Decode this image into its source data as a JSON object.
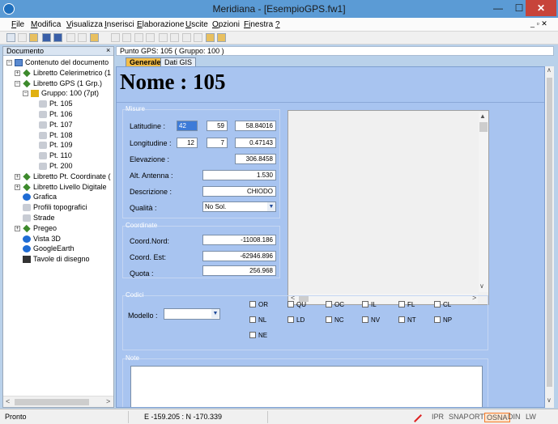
{
  "window": {
    "title": "Meridiana - [EsempioGPS.fw1]",
    "min_label": "—",
    "max_label": "☐",
    "close_label": "✕"
  },
  "menu": {
    "items": [
      {
        "first": "F",
        "rest": "ile"
      },
      {
        "first": "M",
        "rest": "odifica"
      },
      {
        "first": "V",
        "rest": "isualizza"
      },
      {
        "first": "I",
        "rest": "nserisci"
      },
      {
        "first": "E",
        "rest": "laborazione"
      },
      {
        "first": "U",
        "rest": "scite"
      },
      {
        "first": "O",
        "rest": "pzioni"
      },
      {
        "first": "Fi",
        "rest": "nestra"
      },
      {
        "first": "?",
        "rest": ""
      }
    ],
    "mdi_controls": "_ ▫ ✕"
  },
  "left_panel": {
    "title": "Documento",
    "close": "×",
    "tree": [
      {
        "label": "Contenuto del documento",
        "icon": "document-icon"
      },
      {
        "label": "Libretto Celerimetrico (1",
        "icon": "green-diamond-icon"
      },
      {
        "label": "Libretto GPS (1 Grp.)",
        "icon": "green-diamond-icon"
      },
      {
        "label": "Gruppo: 100 (7pt)",
        "icon": "group-icon"
      },
      {
        "label": "Pt. 105",
        "icon": "point-icon"
      },
      {
        "label": "Pt. 106",
        "icon": "point-icon"
      },
      {
        "label": "Pt. 107",
        "icon": "point-icon"
      },
      {
        "label": "Pt. 108",
        "icon": "point-icon"
      },
      {
        "label": "Pt. 109",
        "icon": "point-icon"
      },
      {
        "label": "Pt. 110",
        "icon": "point-icon"
      },
      {
        "label": "Pt. 200",
        "icon": "point-icon"
      },
      {
        "label": "Libretto Pt. Coordinate (",
        "icon": "green-diamond-icon"
      },
      {
        "label": "Libretto Livello Digitale",
        "icon": "green-diamond-icon"
      },
      {
        "label": "Grafica",
        "icon": "graphics-icon"
      },
      {
        "label": "Profili topografici",
        "icon": "profile-icon"
      },
      {
        "label": "Strade",
        "icon": "road-icon"
      },
      {
        "label": "Pregeo",
        "icon": "green-diamond-icon"
      },
      {
        "label": "Vista 3D",
        "icon": "view3d-icon"
      },
      {
        "label": "GoogleEarth",
        "icon": "globe-icon"
      },
      {
        "label": "Tavole di disegno",
        "icon": "drawing-board-icon"
      }
    ]
  },
  "right_panel": {
    "header": "Punto GPS: 105 ( Gruppo: 100 )",
    "tabs": [
      "Generale",
      "Dati GIS"
    ],
    "big_title": "Nome : 105",
    "misure": {
      "title": "Misure",
      "latitudine_label": "Latitudine :",
      "lat_deg": "42",
      "lat_min": "59",
      "lat_sec": "58.84016",
      "longitudine_label": "Longitudine :",
      "lon_deg": "12",
      "lon_min": "7",
      "lon_sec": "0.47143",
      "elevazione_label": "Elevazione :",
      "elevazione": "306.8458",
      "antenna_label": "Alt. Antenna :",
      "antenna": "1.530",
      "descrizione_label": "Descrizione :",
      "descrizione": "CHIODO",
      "qualita_label": "Qualità :",
      "qualita": "No Sol."
    },
    "coordinate": {
      "title": "Coordinate",
      "nord_label": "Coord.Nord:",
      "nord": "-11008.186",
      "est_label": "Coord. Est:",
      "est": "-62946.896",
      "quota_label": "Quota :",
      "quota": "256.968"
    },
    "codici": {
      "title": "Codici",
      "modello_label": "Modello :",
      "modello": "",
      "checks": [
        "OR",
        "QU",
        "OC",
        "IL",
        "FL",
        "CL",
        "NL",
        "LD",
        "NC",
        "NV",
        "NT",
        "NP",
        "NE"
      ]
    },
    "note": {
      "title": "Note",
      "text": ""
    }
  },
  "status": {
    "left": "Pronto",
    "coords": "E  -159.205 : N   -170.339",
    "flags": [
      "IPR",
      "SNAP",
      "ORTO",
      "OSNA",
      "DIN",
      "LW"
    ],
    "active_flag": "OSNA"
  },
  "colors": {
    "titlebar": "#5b9bd5",
    "form_bg": "#a8c4f0",
    "close_red": "#c7443a",
    "active_tab": "#f3bd48",
    "osna_highlight": "#f57c2c"
  }
}
